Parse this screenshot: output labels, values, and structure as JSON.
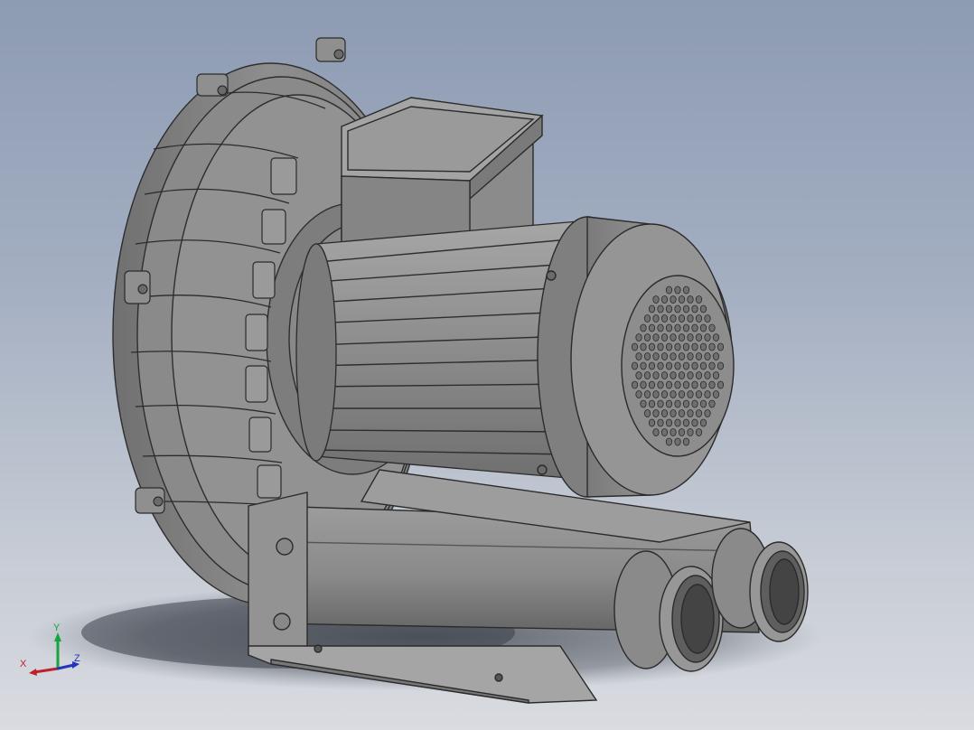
{
  "viewport": {
    "background_top": "#8d9bb3",
    "background_bottom": "#d9dbe0",
    "model_color": "#8a8a8a"
  },
  "triad": {
    "x_label": "X",
    "y_label": "Y",
    "z_label": "Z",
    "x_color": "#c0202a",
    "y_color": "#1aa33a",
    "z_color": "#2436b8"
  }
}
